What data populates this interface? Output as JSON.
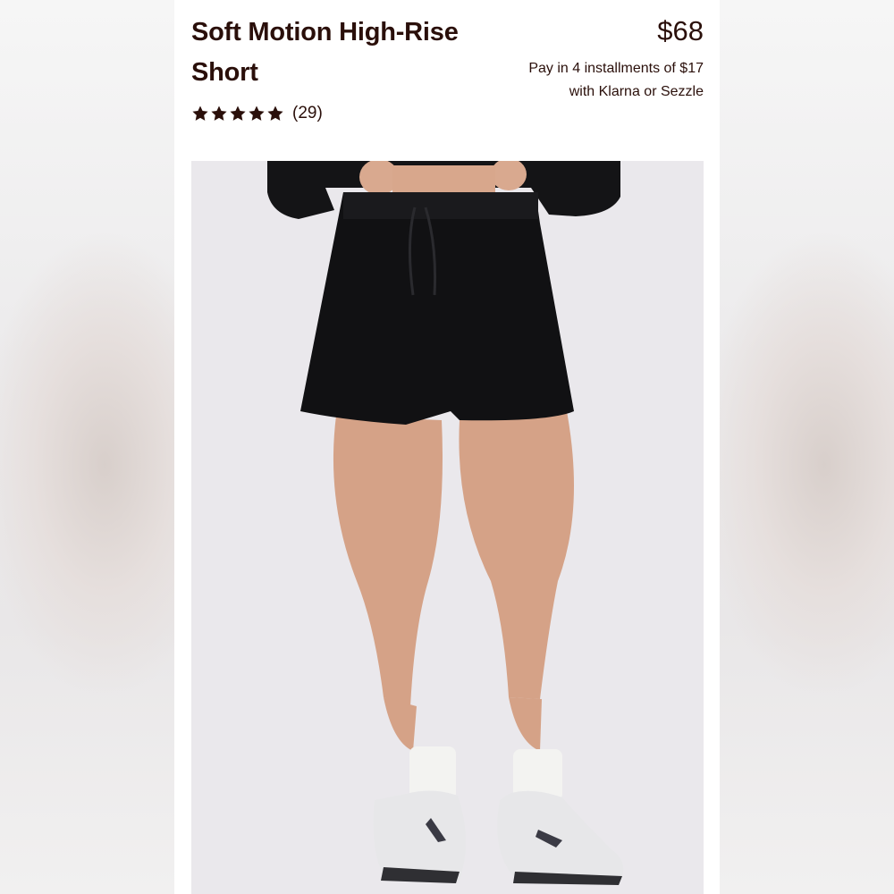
{
  "product": {
    "title_line1": "Soft Motion High-Rise",
    "title_line2": "Short",
    "price": "$68",
    "installments_line1": "Pay in 4 installments of $17",
    "installments_line2": "with Klarna or Sezzle",
    "rating": {
      "stars": 5,
      "max_stars": 5,
      "review_count": "(29)"
    },
    "image": {
      "alt": "model-wearing-black-shorts",
      "background_color": "#eae8ec"
    }
  },
  "colors": {
    "text": "#2a0f0a",
    "card_background": "#ffffff",
    "star": "#2a0f0a"
  }
}
